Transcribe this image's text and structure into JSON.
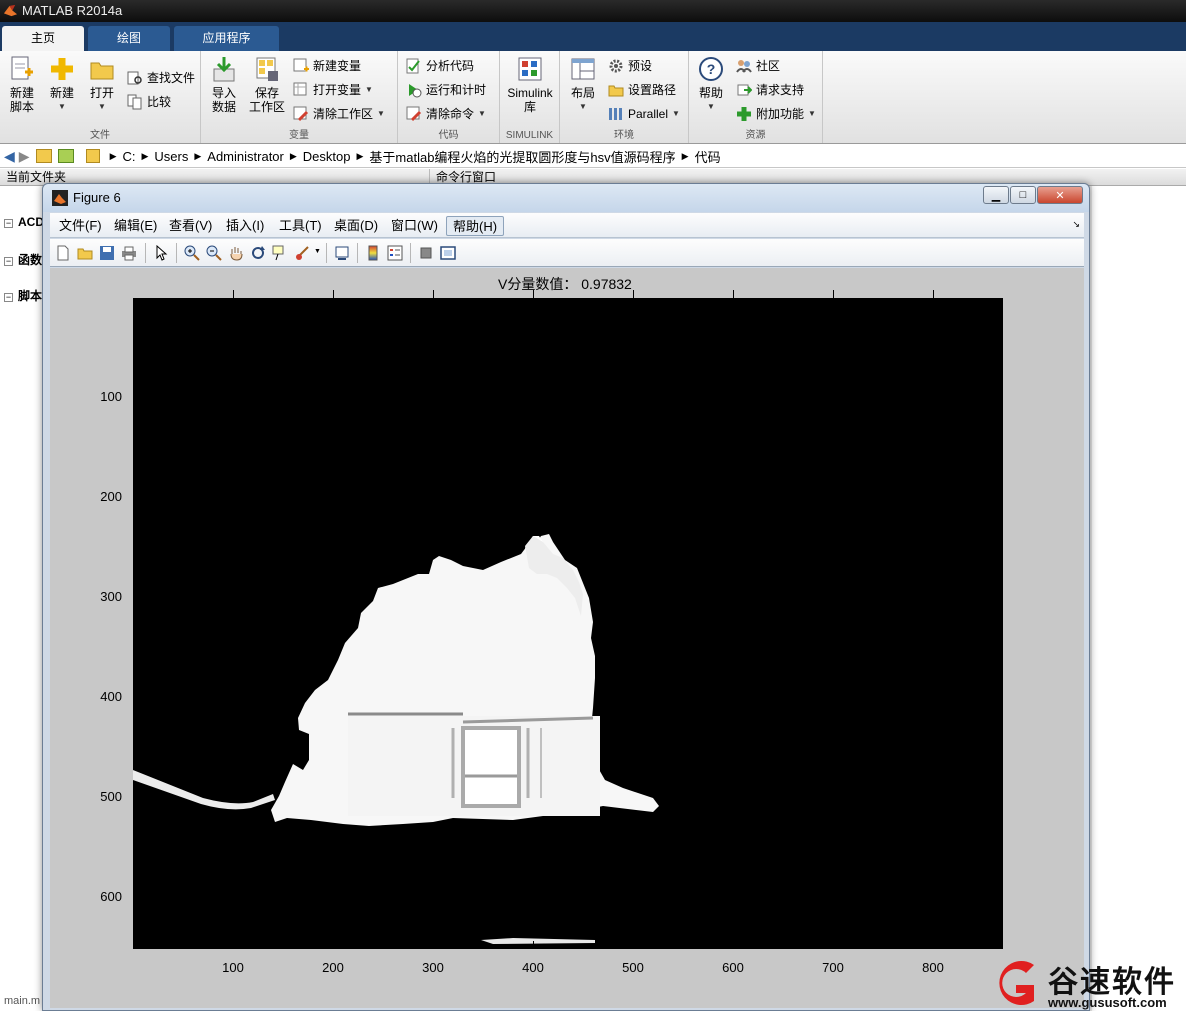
{
  "app": {
    "title": "MATLAB R2014a"
  },
  "tabs": [
    {
      "label": "主页",
      "active": true
    },
    {
      "label": "绘图",
      "active": false
    },
    {
      "label": "应用程序",
      "active": false
    }
  ],
  "ribbon": {
    "file": {
      "label": "文件",
      "new_script": "新建\n脚本",
      "new": "新建",
      "open": "打开",
      "find_files": "查找文件",
      "compare": "比较"
    },
    "variable": {
      "label": "变量",
      "import": "导入\n数据",
      "save_ws": "保存\n工作区",
      "new_var": "新建变量",
      "open_var": "打开变量",
      "clear_ws": "清除工作区"
    },
    "code": {
      "label": "代码",
      "analyze": "分析代码",
      "run_time": "运行和计时",
      "clear_cmd": "清除命令"
    },
    "simulink": {
      "label": "SIMULINK",
      "lib": "Simulink\n库"
    },
    "env": {
      "label": "环境",
      "layout": "布局",
      "prefs": "预设",
      "set_path": "设置路径",
      "parallel": "Parallel"
    },
    "resources": {
      "label": "资源",
      "help": "帮助",
      "community": "社区",
      "support": "请求支持",
      "addons": "附加功能"
    }
  },
  "address": {
    "crumbs": [
      "C:",
      "Users",
      "Administrator",
      "Desktop",
      "基于matlab编程火焰的光提取圆形度与hsv值源码程序",
      "代码"
    ]
  },
  "panels": {
    "current_folder": "当前文件夹",
    "command_window": "命令行窗口",
    "tree": [
      "ACD",
      "函数",
      "脚本"
    ],
    "status_file": "main.m"
  },
  "figure": {
    "title": "Figure 6",
    "menu": [
      "文件(F)",
      "编辑(E)",
      "查看(V)",
      "插入(I)",
      "工具(T)",
      "桌面(D)",
      "窗口(W)",
      "帮助(H)"
    ],
    "plot_title": "V分量数值：  0.97832",
    "yticks": [
      "100",
      "200",
      "300",
      "400",
      "500",
      "600"
    ],
    "xticks": [
      "100",
      "200",
      "300",
      "400",
      "500",
      "600",
      "700",
      "800"
    ]
  },
  "watermark": {
    "text": "谷速软件",
    "url": "www.gususoft.com",
    "color": "#e02020"
  }
}
